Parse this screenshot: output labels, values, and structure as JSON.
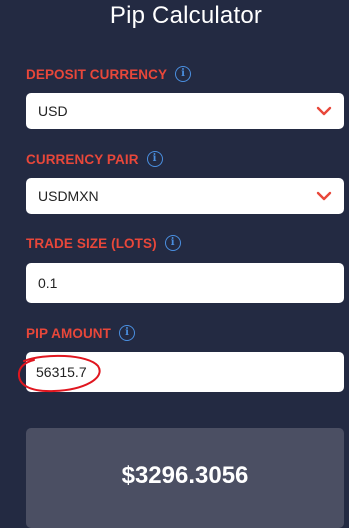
{
  "title": "Pip Calculator",
  "deposit_currency": {
    "label": "DEPOSIT CURRENCY",
    "value": "USD",
    "info_icon": "info-icon",
    "dropdown_icon": "chevron-down-icon"
  },
  "currency_pair": {
    "label": "CURRENCY PAIR",
    "value": "USDMXN",
    "info_icon": "info-icon",
    "dropdown_icon": "chevron-down-icon"
  },
  "trade_size": {
    "label": "TRADE SIZE (LOTS)",
    "value": "0.1",
    "info_icon": "info-icon"
  },
  "pip_amount": {
    "label": "PIP AMOUNT",
    "value": "56315.7",
    "info_icon": "info-icon"
  },
  "result": {
    "value": "$3296.3056"
  },
  "colors": {
    "background": "#232a42",
    "label": "#e8473a",
    "info": "#4a8fe0",
    "chevron": "#e8473a",
    "result_card": "#4b4f63",
    "annotation": "#e0161f"
  }
}
